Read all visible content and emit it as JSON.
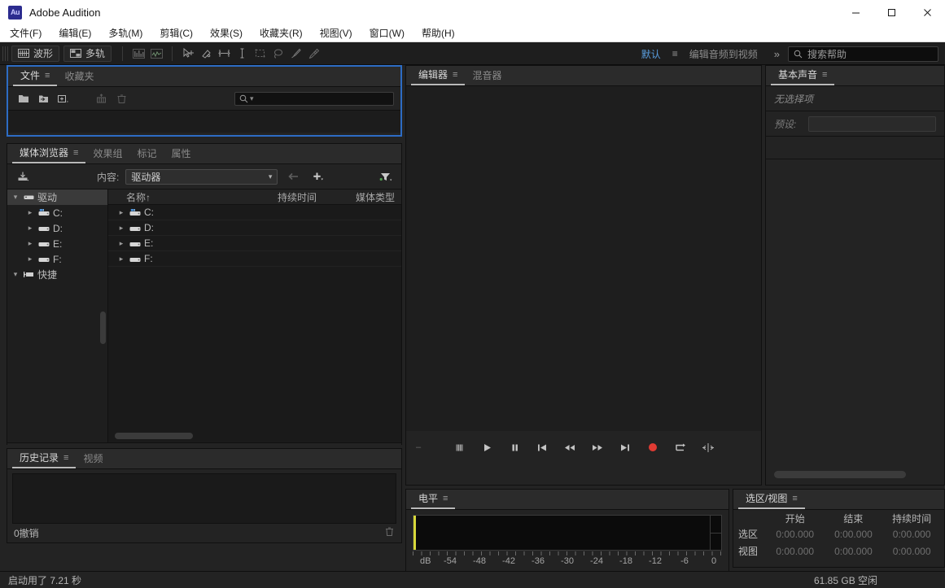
{
  "window": {
    "app_name": "Adobe Audition",
    "logo_text": "Au",
    "controls": {
      "minimize": "minimize-icon",
      "maximize": "maximize-icon",
      "close": "close-icon"
    }
  },
  "menubar": {
    "items": [
      {
        "label": "文件(F)"
      },
      {
        "label": "编辑(E)"
      },
      {
        "label": "多轨(M)"
      },
      {
        "label": "剪辑(C)"
      },
      {
        "label": "效果(S)"
      },
      {
        "label": "收藏夹(R)"
      },
      {
        "label": "视图(V)"
      },
      {
        "label": "窗口(W)"
      },
      {
        "label": "帮助(H)"
      }
    ]
  },
  "toolbar": {
    "waveform_label": "波形",
    "multitrack_label": "多轨",
    "view_icons": [
      "spectral-frequency-icon",
      "spectral-pitch-icon"
    ],
    "tools": [
      "move-tool-icon",
      "slip-tool-icon",
      "time-selection-tool-icon",
      "razor-tool-icon",
      "marquee-selection-tool-icon",
      "lasso-selection-tool-icon",
      "paintbrush-selection-tool-icon",
      "spot-healing-brush-icon"
    ],
    "workspace_active": "默认",
    "workspace_other": "编辑音频到视频",
    "more_label": "»",
    "search_placeholder": "搜索帮助"
  },
  "files_panel": {
    "tabs": [
      {
        "label": "文件",
        "active": true,
        "has_menu": true
      },
      {
        "label": "收藏夹",
        "active": false,
        "has_menu": false
      }
    ],
    "tools": [
      "open-file-icon",
      "import-file-icon",
      "new-file-icon",
      "insert-into-multitrack-icon",
      "close-selected-files-icon"
    ],
    "search_placeholder": ""
  },
  "media_browser": {
    "tabs": [
      {
        "label": "媒体浏览器",
        "active": true,
        "has_menu": true
      },
      {
        "label": "效果组",
        "active": false,
        "has_menu": false
      },
      {
        "label": "标记",
        "active": false,
        "has_menu": false
      },
      {
        "label": "属性",
        "active": false,
        "has_menu": false
      }
    ],
    "import_icon": "import-icon",
    "content_label": "内容:",
    "content_value": "驱动器",
    "back_icon": "back-arrow-icon",
    "add_icon": "add-shortcut-icon",
    "filter_icon": "filter-icon",
    "tree": [
      {
        "label": "驱动",
        "icon": "drive-group-icon",
        "level": 0,
        "expanded": true,
        "selected": true
      },
      {
        "label": "C:",
        "icon": "drive-c-icon",
        "level": 1,
        "expanded": false,
        "selected": false
      },
      {
        "label": "D:",
        "icon": "drive-icon",
        "level": 1,
        "expanded": false,
        "selected": false
      },
      {
        "label": "E:",
        "icon": "drive-icon",
        "level": 1,
        "expanded": false,
        "selected": false
      },
      {
        "label": "F:",
        "icon": "drive-icon",
        "level": 1,
        "expanded": false,
        "selected": false
      },
      {
        "label": "快捷",
        "icon": "shortcut-icon",
        "level": 0,
        "expanded": true,
        "selected": false
      }
    ],
    "columns": [
      {
        "label": "名称",
        "sort": "↑"
      },
      {
        "label": "持续时间"
      },
      {
        "label": "媒体类型"
      }
    ],
    "rows": [
      {
        "name": "C:",
        "icon": "drive-c-icon",
        "duration": "",
        "type": ""
      },
      {
        "name": "D:",
        "icon": "drive-icon",
        "duration": "",
        "type": ""
      },
      {
        "name": "E:",
        "icon": "drive-icon",
        "duration": "",
        "type": ""
      },
      {
        "name": "F:",
        "icon": "drive-icon",
        "duration": "",
        "type": ""
      }
    ],
    "footer_icons": [
      "preview-play-icon",
      "auto-play-icon",
      "preview-volume-icon"
    ]
  },
  "history_panel": {
    "tabs": [
      {
        "label": "历史记录",
        "active": true,
        "has_menu": true
      },
      {
        "label": "视频",
        "active": false,
        "has_menu": false
      }
    ],
    "undo_count_label": "0撤销",
    "clear_icon": "trash-icon"
  },
  "editor_panel": {
    "tabs": [
      {
        "label": "编辑器",
        "active": true,
        "has_menu": true
      },
      {
        "label": "混音器",
        "active": false,
        "has_menu": false
      }
    ],
    "transport": [
      {
        "name": "stop-button",
        "glyph": "stop"
      },
      {
        "name": "play-button",
        "glyph": "play"
      },
      {
        "name": "pause-button",
        "glyph": "pause"
      },
      {
        "name": "move-playhead-to-previous-button",
        "glyph": "skip-back"
      },
      {
        "name": "rewind-button",
        "glyph": "rewind"
      },
      {
        "name": "fast-forward-button",
        "glyph": "forward"
      },
      {
        "name": "move-playhead-to-next-button",
        "glyph": "skip-fwd"
      },
      {
        "name": "record-button",
        "glyph": "record"
      },
      {
        "name": "loop-playback-button",
        "glyph": "loop"
      },
      {
        "name": "skip-selection-button",
        "glyph": "skip-sel"
      }
    ]
  },
  "levels_panel": {
    "tabs": [
      {
        "label": "电平",
        "active": true,
        "has_menu": true
      }
    ],
    "axis_label": "dB",
    "ticks": [
      "-54",
      "-48",
      "-42",
      "-36",
      "-30",
      "-24",
      "-18",
      "-12",
      "-6",
      "0"
    ]
  },
  "essential_sound": {
    "tabs": [
      {
        "label": "基本声音",
        "active": true,
        "has_menu": true
      }
    ],
    "empty_text": "无选择项",
    "preset_label": "预设:",
    "preset_value": ""
  },
  "selection_view": {
    "tabs": [
      {
        "label": "选区/视图",
        "active": true,
        "has_menu": true
      }
    ],
    "columns": [
      "开始",
      "结束",
      "持续时间"
    ],
    "rows": [
      {
        "label": "选区",
        "start": "0:00.000",
        "end": "0:00.000",
        "duration": "0:00.000"
      },
      {
        "label": "视图",
        "start": "0:00.000",
        "end": "0:00.000",
        "duration": "0:00.000"
      }
    ]
  },
  "statusbar": {
    "left_text": "启动用了 7.21 秒",
    "right_text": "61.85 GB 空闲"
  },
  "colors": {
    "accent_blue": "#5a9fe0",
    "panel_focus_border": "#2d6cc4",
    "record_red": "#e03b33",
    "meter_yellow": "#d8d83a",
    "titlebar_bg": "#ffffff",
    "panel_bg": "#232323"
  }
}
